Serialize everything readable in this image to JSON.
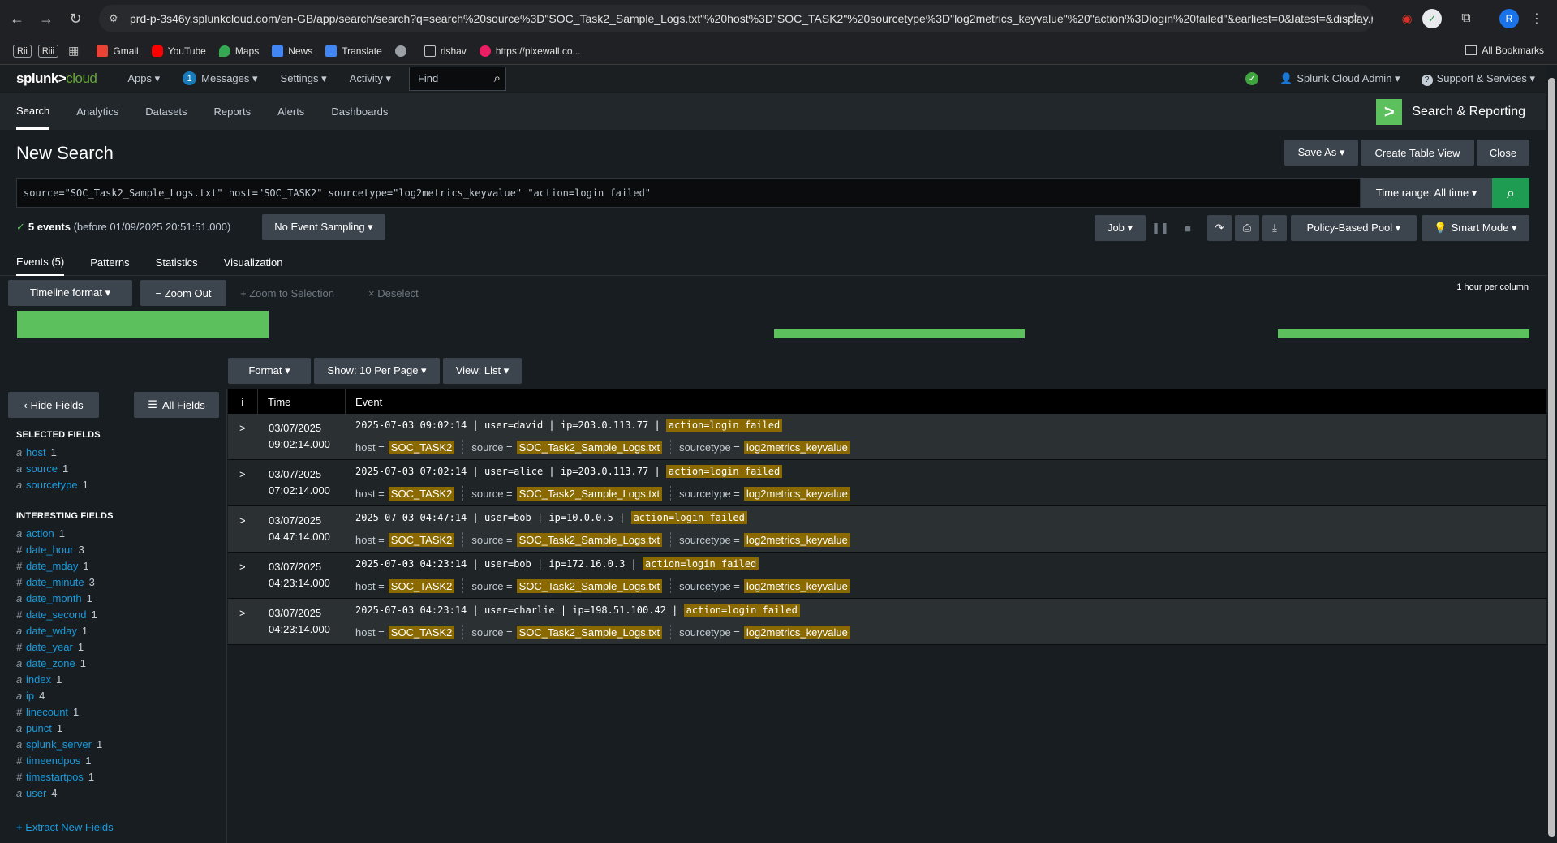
{
  "browser": {
    "url": "prd-p-3s46y.splunkcloud.com/en-GB/app/search/search?q=search%20source%3D\"SOC_Task2_Sample_Logs.txt\"%20host%3D\"SOC_TASK2\"%20sourcetype%3D\"log2metrics_keyvalue\"%20\"action%3Dlogin%20failed\"&earliest=0&latest=&display.pa...",
    "profile_initial": "R",
    "bookmarks": [
      {
        "label": "Rii"
      },
      {
        "label": "Riii"
      },
      {
        "label": "Gmail"
      },
      {
        "label": "YouTube"
      },
      {
        "label": "Maps"
      },
      {
        "label": "News"
      },
      {
        "label": "Translate"
      },
      {
        "label": ""
      },
      {
        "label": "rishav"
      },
      {
        "label": "https://pixewall.co..."
      }
    ],
    "all_bookmarks": "All Bookmarks"
  },
  "splunk_nav": {
    "logo_main": "splunk>",
    "logo_sub": "cloud",
    "apps": "Apps ▾",
    "messages_count": "1",
    "messages": "Messages ▾",
    "settings": "Settings ▾",
    "activity": "Activity ▾",
    "find_placeholder": "Find",
    "admin": "Splunk Cloud Admin ▾",
    "support": "Support & Services ▾"
  },
  "app_bar": {
    "tabs": [
      "Search",
      "Analytics",
      "Datasets",
      "Reports",
      "Alerts",
      "Dashboards"
    ],
    "app_icon": ">",
    "app_name": "Search & Reporting"
  },
  "search": {
    "title": "New Search",
    "save_as": "Save As ▾",
    "create_table": "Create Table View",
    "close": "Close",
    "query": "source=\"SOC_Task2_Sample_Logs.txt\" host=\"SOC_TASK2\" sourcetype=\"log2metrics_keyvalue\" \"action=login failed\"",
    "time_range": "Time range: All time ▾",
    "status_count": "5 events",
    "status_rest": "(before 01/09/2025 20:51:51.000)",
    "sampling": "No Event Sampling ▾",
    "job": "Job ▾",
    "pool": "Policy-Based Pool ▾",
    "mode": "Smart Mode ▾"
  },
  "result_tabs": [
    "Events (5)",
    "Patterns",
    "Statistics",
    "Visualization"
  ],
  "timeline": {
    "format": "Timeline format ▾",
    "zoom_out": "− Zoom Out",
    "zoom_sel": "+ Zoom to Selection",
    "deselect": "× Deselect",
    "scale": "1 hour per column"
  },
  "event_toolbar": {
    "format": "Format ▾",
    "show": "Show: 10 Per Page ▾",
    "view": "View: List ▾"
  },
  "sidebar": {
    "hide_fields": "Hide Fields",
    "all_fields": "All Fields",
    "selected_heading": "SELECTED FIELDS",
    "selected": [
      {
        "type": "a",
        "name": "host",
        "count": "1"
      },
      {
        "type": "a",
        "name": "source",
        "count": "1"
      },
      {
        "type": "a",
        "name": "sourcetype",
        "count": "1"
      }
    ],
    "interesting_heading": "INTERESTING FIELDS",
    "interesting": [
      {
        "type": "a",
        "name": "action",
        "count": "1"
      },
      {
        "type": "#",
        "name": "date_hour",
        "count": "3"
      },
      {
        "type": "#",
        "name": "date_mday",
        "count": "1"
      },
      {
        "type": "#",
        "name": "date_minute",
        "count": "3"
      },
      {
        "type": "a",
        "name": "date_month",
        "count": "1"
      },
      {
        "type": "#",
        "name": "date_second",
        "count": "1"
      },
      {
        "type": "a",
        "name": "date_wday",
        "count": "1"
      },
      {
        "type": "#",
        "name": "date_year",
        "count": "1"
      },
      {
        "type": "a",
        "name": "date_zone",
        "count": "1"
      },
      {
        "type": "a",
        "name": "index",
        "count": "1"
      },
      {
        "type": "a",
        "name": "ip",
        "count": "4"
      },
      {
        "type": "#",
        "name": "linecount",
        "count": "1"
      },
      {
        "type": "a",
        "name": "punct",
        "count": "1"
      },
      {
        "type": "a",
        "name": "splunk_server",
        "count": "1"
      },
      {
        "type": "#",
        "name": "timeendpos",
        "count": "1"
      },
      {
        "type": "#",
        "name": "timestartpos",
        "count": "1"
      },
      {
        "type": "a",
        "name": "user",
        "count": "4"
      }
    ],
    "extract": "+ Extract New Fields"
  },
  "events_table": {
    "col_info": "i",
    "col_time": "Time",
    "col_event": "Event",
    "meta_host_key": "host =",
    "meta_source_key": "source =",
    "meta_sourcetype_key": "sourcetype =",
    "rows": [
      {
        "date": "03/07/2025",
        "time": "09:02:14.000",
        "raw": "2025-07-03 09:02:14 | user=david | ip=203.0.113.77 |",
        "hl": "action=login failed",
        "host": "SOC_TASK2",
        "source": "SOC_Task2_Sample_Logs.txt",
        "sourcetype": "log2metrics_keyvalue"
      },
      {
        "date": "03/07/2025",
        "time": "07:02:14.000",
        "raw": "2025-07-03 07:02:14 | user=alice | ip=203.0.113.77 |",
        "hl": "action=login failed",
        "host": "SOC_TASK2",
        "source": "SOC_Task2_Sample_Logs.txt",
        "sourcetype": "log2metrics_keyvalue"
      },
      {
        "date": "03/07/2025",
        "time": "04:47:14.000",
        "raw": "2025-07-03 04:47:14 | user=bob | ip=10.0.0.5 |",
        "hl": "action=login failed",
        "host": "SOC_TASK2",
        "source": "SOC_Task2_Sample_Logs.txt",
        "sourcetype": "log2metrics_keyvalue"
      },
      {
        "date": "03/07/2025",
        "time": "04:23:14.000",
        "raw": "2025-07-03 04:23:14 | user=bob | ip=172.16.0.3 |",
        "hl": "action=login failed",
        "host": "SOC_TASK2",
        "source": "SOC_Task2_Sample_Logs.txt",
        "sourcetype": "log2metrics_keyvalue"
      },
      {
        "date": "03/07/2025",
        "time": "04:23:14.000",
        "raw": "2025-07-03 04:23:14 | user=charlie | ip=198.51.100.42 |",
        "hl": "action=login failed",
        "host": "SOC_TASK2",
        "source": "SOC_Task2_Sample_Logs.txt",
        "sourcetype": "log2metrics_keyvalue"
      }
    ]
  },
  "colors": {
    "accent_green": "#5cc05c",
    "highlight": "#8a6a00",
    "link_blue": "#1a9bdc"
  }
}
